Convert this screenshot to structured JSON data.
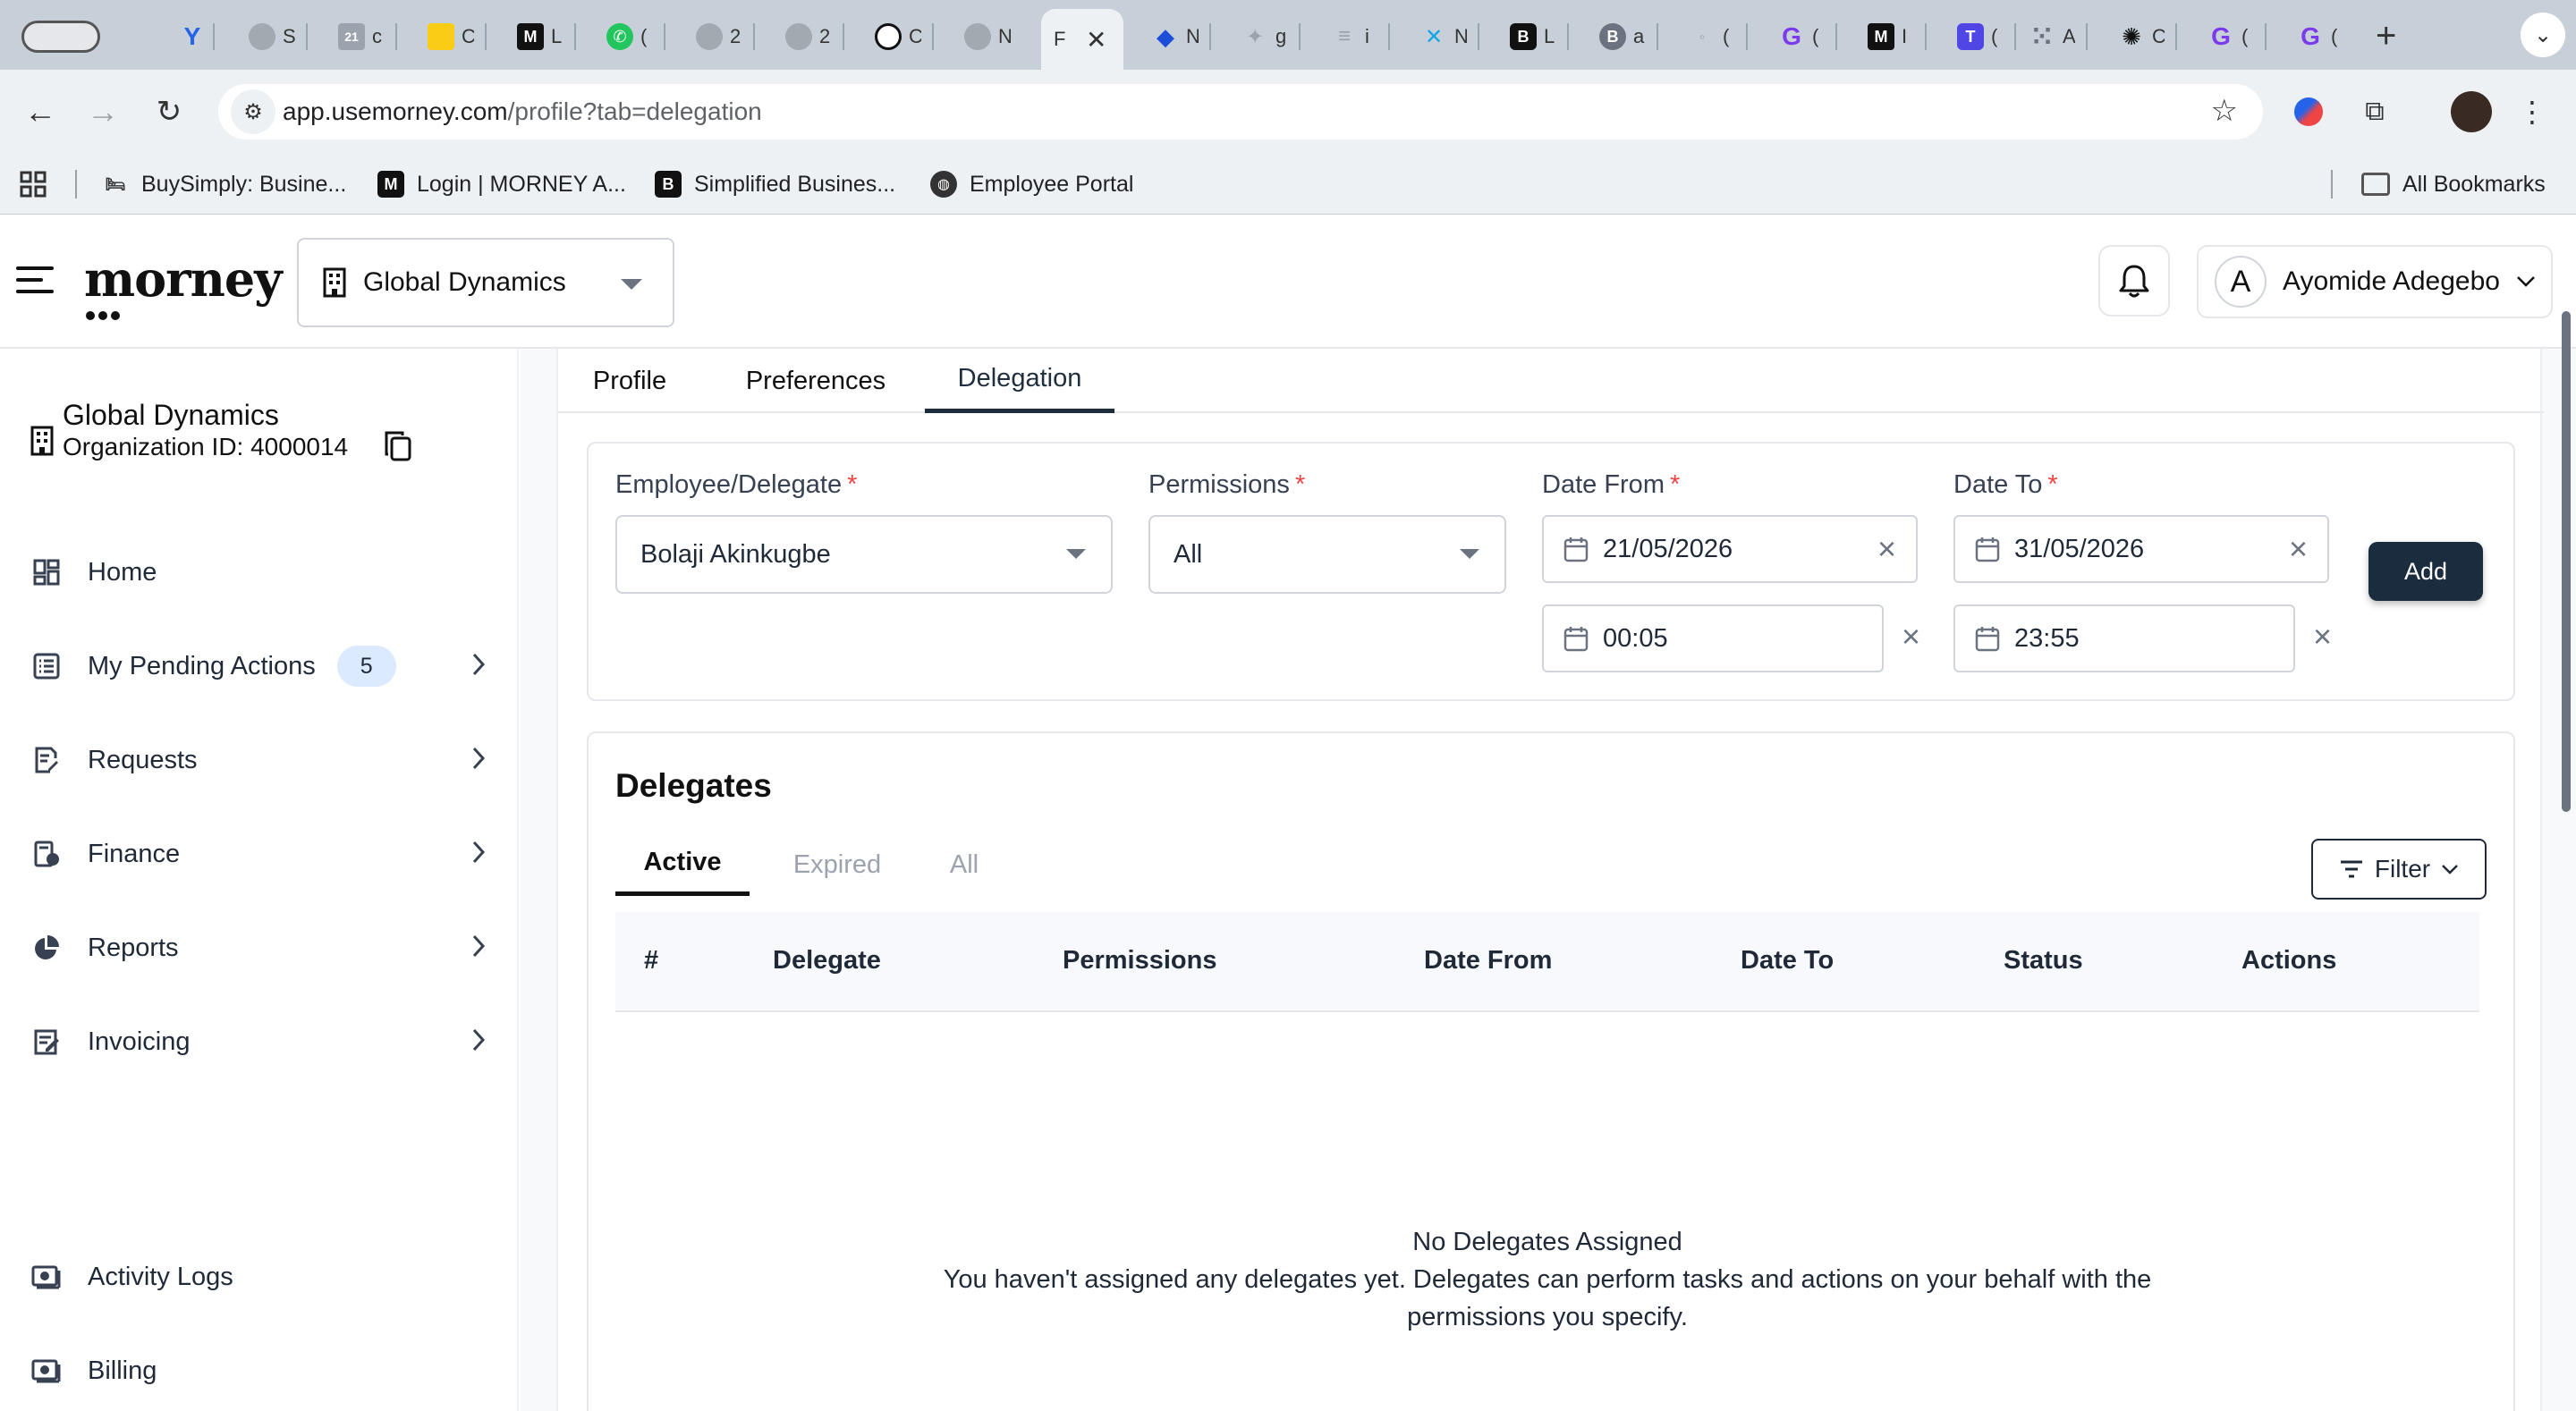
{
  "browser": {
    "tabs": [
      {
        "fav": "▭",
        "title": "",
        "color": "#6b7280"
      },
      {
        "fav": "Y",
        "title": "",
        "color": "#2563eb"
      },
      {
        "fav": "●",
        "title": "S",
        "color": "#9ca3af"
      },
      {
        "fav": "21",
        "title": "c",
        "color": "#9ca3af"
      },
      {
        "fav": "■",
        "title": "C",
        "color": "#facc15"
      },
      {
        "fav": "M",
        "title": "L",
        "color": "#111111"
      },
      {
        "fav": "✆",
        "title": "(",
        "color": "#22c55e"
      },
      {
        "fav": "●",
        "title": "2",
        "color": "#9ca3af"
      },
      {
        "fav": "●",
        "title": "2",
        "color": "#9ca3af"
      },
      {
        "fav": "◉",
        "title": "C",
        "color": "#111111"
      },
      {
        "fav": "●",
        "title": "N",
        "color": "#9ca3af"
      },
      {
        "fav": "",
        "title": "F",
        "color": "#9ca3af",
        "active": true
      },
      {
        "fav": "◆",
        "title": "N",
        "color": "#1d4ed8"
      },
      {
        "fav": "✦",
        "title": "g",
        "color": "#9ca3af"
      },
      {
        "fav": "≡",
        "title": "i",
        "color": "#9ca3af"
      },
      {
        "fav": "✕",
        "title": "N",
        "color": "#0ea5e9"
      },
      {
        "fav": "B",
        "title": "L",
        "color": "#111111"
      },
      {
        "fav": "B",
        "title": "a",
        "color": "#6b7280"
      },
      {
        "fav": "◦",
        "title": "(",
        "color": "#9ca3af"
      },
      {
        "fav": "G",
        "title": "(",
        "color": "#7c3aed"
      },
      {
        "fav": "M",
        "title": "I",
        "color": "#111111"
      },
      {
        "fav": "T",
        "title": "(",
        "color": "#4f46e5"
      },
      {
        "fav": "⁙",
        "title": "A",
        "color": "#6b7280"
      },
      {
        "fav": "✺",
        "title": "C",
        "color": "#111111"
      },
      {
        "fav": "G",
        "title": "(",
        "color": "#7c3aed"
      },
      {
        "fav": "G",
        "title": "(",
        "color": "#7c3aed"
      }
    ],
    "address_host": "app.usemorney.com",
    "address_path": "/profile?tab=delegation",
    "bookmarks": [
      {
        "label": "BuySimply: Busine...",
        "icon": "bed-icon"
      },
      {
        "label": "Login | MORNEY A...",
        "icon": "morney-icon"
      },
      {
        "label": "Simplified Busines...",
        "icon": "b-logo-icon"
      },
      {
        "label": "Employee Portal",
        "icon": "globe-icon"
      }
    ],
    "all_bookmarks": "All Bookmarks"
  },
  "header": {
    "logo": "morney",
    "org_selector": "Global Dynamics",
    "user_initial": "A",
    "user_name": "Ayomide Adegebo"
  },
  "sidebar": {
    "org_name": "Global Dynamics",
    "org_id_label": "Organization ID: 4000014",
    "items": [
      {
        "label": "Home",
        "icon": "dashboard-icon",
        "has_chevron": false
      },
      {
        "label": "My Pending Actions",
        "icon": "list-icon",
        "badge": "5",
        "has_chevron": true
      },
      {
        "label": "Requests",
        "icon": "edit-document-icon",
        "has_chevron": true
      },
      {
        "label": "Finance",
        "icon": "finance-icon",
        "has_chevron": true
      },
      {
        "label": "Reports",
        "icon": "pie-chart-icon",
        "has_chevron": true
      },
      {
        "label": "Invoicing",
        "icon": "invoice-icon",
        "has_chevron": true
      }
    ],
    "bottom_items": [
      {
        "label": "Activity Logs",
        "icon": "activity-icon"
      },
      {
        "label": "Billing",
        "icon": "billing-icon"
      }
    ]
  },
  "page_tabs": [
    {
      "label": "Profile"
    },
    {
      "label": "Preferences"
    },
    {
      "label": "Delegation",
      "active": true
    }
  ],
  "delegation_form": {
    "employee_label": "Employee/Delegate",
    "employee_value": "Bolaji Akinkugbe",
    "permissions_label": "Permissions",
    "permissions_value": "All",
    "date_from_label": "Date From",
    "date_from_value": "21/05/2026",
    "time_from_value": "00:05",
    "date_to_label": "Date To",
    "date_to_value": "31/05/2026",
    "time_to_value": "23:55",
    "required_marker": "*",
    "add_label": "Add"
  },
  "delegates": {
    "title": "Delegates",
    "tabs": [
      {
        "label": "Active",
        "active": true
      },
      {
        "label": "Expired"
      },
      {
        "label": "All"
      }
    ],
    "filter_label": "Filter",
    "columns": [
      "#",
      "Delegate",
      "Permissions",
      "Date From",
      "Date To",
      "Status",
      "Actions"
    ],
    "empty_title": "No Delegates Assigned",
    "empty_line1": "You haven't assigned any delegates yet. Delegates can perform tasks and actions on your behalf with the",
    "empty_line2": "permissions you specify."
  },
  "colors": {
    "primary": "#1b2c3e",
    "required": "#ef4444",
    "badge_bg": "#dbeafe"
  }
}
